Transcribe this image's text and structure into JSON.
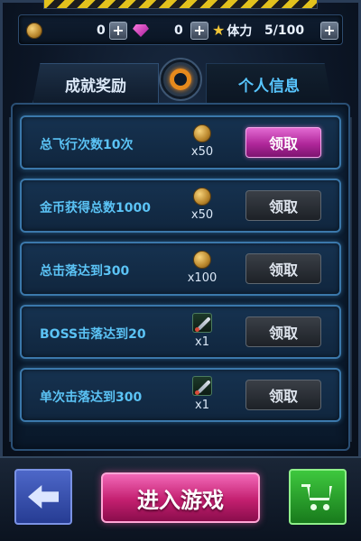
{
  "resources": {
    "coins": "0",
    "gems": "0",
    "stamina_label": "体力",
    "stamina_value": "5/100"
  },
  "tabs": {
    "achievements": "成就奖励",
    "profile": "个人信息"
  },
  "achievements": [
    {
      "title": "总飞行次数10次",
      "reward_icon": "coin-icon",
      "qty": "x50",
      "claim": "领取",
      "claimable": true
    },
    {
      "title": "金币获得总数1000",
      "reward_icon": "coin-icon",
      "qty": "x50",
      "claim": "领取",
      "claimable": false
    },
    {
      "title": "总击落达到300",
      "reward_icon": "coin-icon",
      "qty": "x100",
      "claim": "领取",
      "claimable": false
    },
    {
      "title": "BOSS击落达到20",
      "reward_icon": "missile-icon",
      "qty": "x1",
      "claim": "领取",
      "claimable": false
    },
    {
      "title": "单次击落达到300",
      "reward_icon": "missile-icon",
      "qty": "x1",
      "claim": "领取",
      "claimable": false
    }
  ],
  "bottom": {
    "enter_game": "进入游戏",
    "back_icon": "back-arrow-icon",
    "shop_icon": "shopping-cart-icon"
  },
  "colors": {
    "claim_active": "#b0279a",
    "enter_button": "#c31f6f",
    "shop_button": "#187a1c",
    "back_button": "#263c93",
    "title_text": "#5bc3f5"
  }
}
